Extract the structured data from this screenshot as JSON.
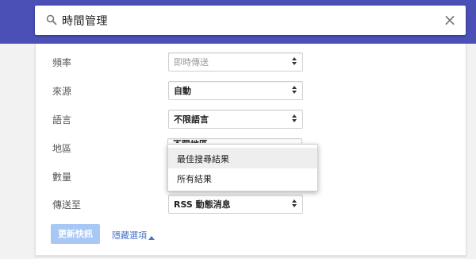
{
  "search": {
    "query": "時間管理"
  },
  "options": {
    "rows": [
      {
        "label": "頻率",
        "value": "即時傳送"
      },
      {
        "label": "來源",
        "value": "自動"
      },
      {
        "label": "語言",
        "value": "不限語言"
      },
      {
        "label": "地區",
        "value": "不限地區"
      },
      {
        "label": "數量",
        "value": ""
      },
      {
        "label": "傳送至",
        "value": "RSS 動態消息"
      }
    ]
  },
  "dropdown": {
    "items": [
      {
        "label": "最佳搜尋結果"
      },
      {
        "label": "所有結果"
      }
    ]
  },
  "actions": {
    "update_label": "更新快訊",
    "hide_options_label": "隱藏選項"
  },
  "colors": {
    "header": "#4a50b6",
    "button": "#a7c7f4",
    "link": "#4a73c8"
  }
}
